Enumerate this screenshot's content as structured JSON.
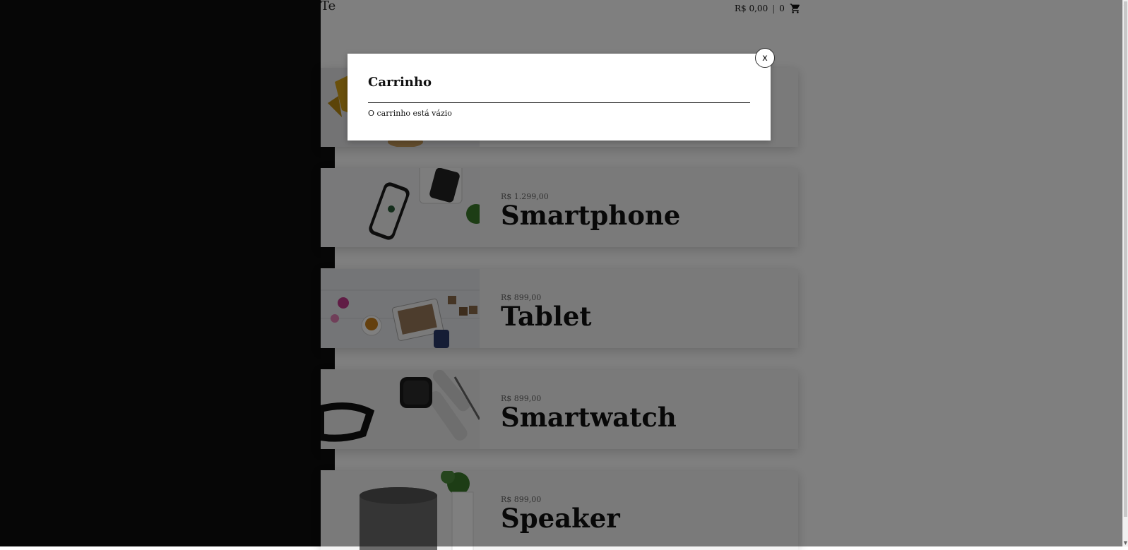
{
  "header": {
    "store_title": "Te",
    "cart_total": "R$ 0,00",
    "separator": "|",
    "cart_count": "0",
    "cart_icon": "shopping-cart-icon"
  },
  "products": [
    {
      "price": "",
      "name": ""
    },
    {
      "price": "R$ 1.299,00",
      "name": "Smartphone"
    },
    {
      "price": "R$ 899,00",
      "name": "Tablet"
    },
    {
      "price": "R$ 899,00",
      "name": "Smartwatch"
    },
    {
      "price": "R$ 899,00",
      "name": "Speaker"
    }
  ],
  "modal": {
    "title": "Carrinho",
    "message": "O carrinho está vázio",
    "close_label": "x"
  },
  "colors": {
    "overlay": "rgba(0,0,0,0.5)",
    "sidebar": "#0c0c0c",
    "card_background": "#f4f4f4"
  }
}
